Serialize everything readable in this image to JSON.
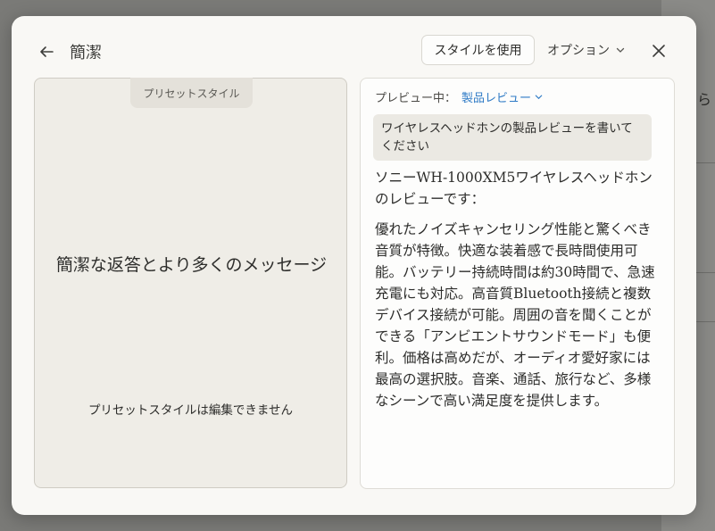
{
  "header": {
    "title": "簡潔",
    "use_style_label": "スタイルを使用",
    "options_label": "オプション"
  },
  "left_panel": {
    "tab_label": "プリセットスタイル",
    "style_description": "簡潔な返答とより多くのメッセージ",
    "not_editable_note": "プリセットスタイルは編集できません"
  },
  "right_panel": {
    "preview_label": "プレビュー中：",
    "preview_selected": "製品レビュー",
    "user_prompt": "ワイヤレスヘッドホンの製品レビューを書いてください",
    "response_intro": "ソニーWH-1000XM5ワイヤレスヘッドホンのレビューです：",
    "response_body": "優れたノイズキャンセリング性能と驚くべき音質が特徴。快適な装着感で長時間使用可能。バッテリー持続時間は約30時間で、急速充電にも対応。高音質Bluetooth接続と複数デバイス接続が可能。周囲の音を聞くことができる「アンビエントサウンドモード」も便利。価格は高めだが、オーディオ愛好家には最高の選択肢。音楽、通話、旅行など、多様なシーンで高い満足度を提供します。"
  },
  "colors": {
    "accent_link": "#2f7bc6",
    "modal_bg": "#f9f8f5",
    "overlay": "#7a7a77"
  },
  "icons": {
    "back": "arrow-left-icon",
    "options_chevron": "chevron-down-icon",
    "close": "close-icon",
    "preview_chevron": "chevron-down-icon"
  }
}
